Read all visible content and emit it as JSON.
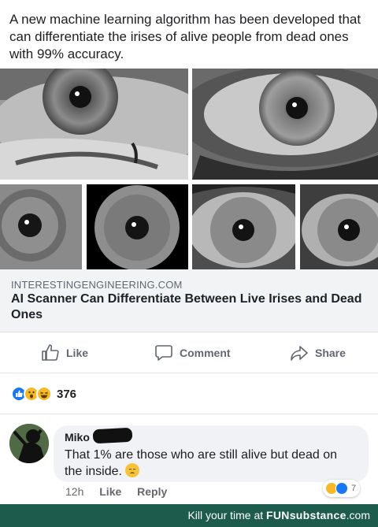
{
  "post": {
    "text": "A new machine learning algorithm has been developed that can differentiate the irises of alive people from dead ones with 99% accuracy."
  },
  "photos": [
    {
      "icon": "eye-photo-closeup-left"
    },
    {
      "icon": "eye-photo-closeup-right"
    },
    {
      "icon": "iris-photo-1"
    },
    {
      "icon": "iris-photo-2"
    },
    {
      "icon": "iris-photo-3"
    },
    {
      "icon": "iris-photo-4"
    }
  ],
  "link": {
    "domain": "INTERESTINGENGINEERING.COM",
    "title": "AI Scanner Can Differentiate Between Live Irises and Dead Ones"
  },
  "actions": {
    "like": "Like",
    "comment": "Comment",
    "share": "Share"
  },
  "reactions": {
    "count": "376",
    "icons": [
      "like-icon",
      "wow-icon",
      "haha-icon"
    ]
  },
  "comment": {
    "author": "Miko",
    "text": "That 1% are those who are still alive but dead on the inside.",
    "emoji": "disappointed-face-icon",
    "time": "12h",
    "like_label": "Like",
    "reply_label": "Reply",
    "reaction_count": "7"
  },
  "footer": {
    "prefix": "Kill your time at ",
    "brand": "FUNsubstance",
    "suffix": ".com"
  },
  "colors": {
    "accent": "#1877f2",
    "footer_bg": "#1d5b4c",
    "emoji_yellow": "#f7b928"
  }
}
